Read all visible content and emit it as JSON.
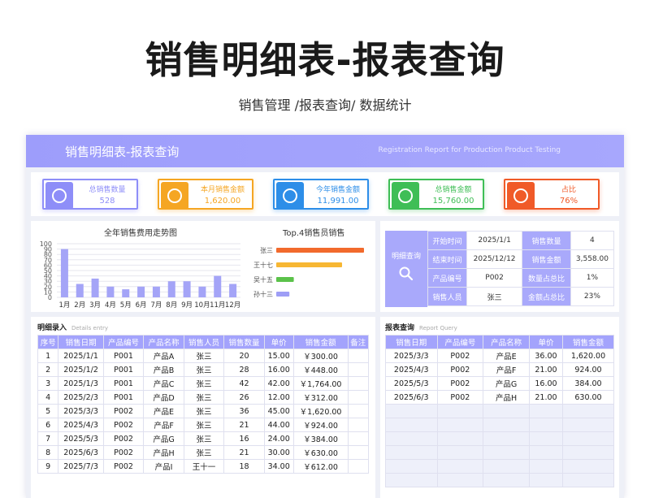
{
  "page": {
    "title": "销售明细表-报表查询",
    "subtitle": "销售管理 /报表查询/ 数据统计"
  },
  "banner": {
    "title": "销售明细表-报表查询",
    "subtitle_en": "Registration Report for Production Product Testing"
  },
  "kpis": [
    {
      "label": "总销售数量",
      "value": "528",
      "color": "#8e8ef8",
      "icon": "hexagon-icon"
    },
    {
      "label": "本月销售金额",
      "value": "1,620.00",
      "color": "#f5a623",
      "icon": "chart-icon"
    },
    {
      "label": "今年销售金额",
      "value": "11,991.00",
      "color": "#2d8ee8",
      "icon": "bar-chart-icon"
    },
    {
      "label": "总销售金额",
      "value": "15,760.00",
      "color": "#3fbe56",
      "icon": "stack-icon"
    },
    {
      "label": "占比",
      "value": "76%",
      "color": "#f05a28",
      "icon": "hexagon-icon"
    }
  ],
  "chart_data": [
    {
      "type": "bar",
      "title": "全年销售费用走势图",
      "categories": [
        "1月",
        "2月",
        "3月",
        "4月",
        "5月",
        "6月",
        "7月",
        "8月",
        "9月",
        "10月",
        "11月",
        "12月"
      ],
      "values": [
        90,
        25,
        35,
        20,
        15,
        20,
        20,
        30,
        30,
        20,
        40,
        25
      ],
      "ylim": [
        0,
        100
      ],
      "yticks": [
        "100",
        "90",
        "80",
        "70",
        "60",
        "50",
        "40",
        "30",
        "20",
        "10",
        "0"
      ],
      "grid": true,
      "color": "#a4a4f7"
    },
    {
      "type": "bar",
      "orientation": "horizontal",
      "title": "Top.4销售员销售",
      "categories": [
        "张三",
        "王十七",
        "吴十五",
        "孙十三"
      ],
      "values": [
        100,
        75,
        20,
        15
      ],
      "colors": [
        "#f26a2c",
        "#f7b733",
        "#5bc24a",
        "#9e9ef6"
      ]
    }
  ],
  "query_info": {
    "button_label": "明细查询",
    "rows": [
      {
        "k1": "开始时间",
        "v1": "2025/1/1",
        "k2": "销售数量",
        "v2": "4"
      },
      {
        "k1": "结束时间",
        "v1": "2025/12/12",
        "k2": "销售金额",
        "v2": "3,558.00"
      },
      {
        "k1": "产品编号",
        "v1": "P002",
        "k2": "数量占总比",
        "v2": "1%"
      },
      {
        "k1": "销售人员",
        "v1": "张三",
        "k2": "金额占总比",
        "v2": "23%"
      }
    ]
  },
  "detail_table": {
    "title": "明细录入",
    "title_en": "Details entry",
    "headers": [
      "序号",
      "销售日期",
      "产品编号",
      "产品名称",
      "销售人员",
      "销售数量",
      "单价",
      "销售金额",
      "备注"
    ],
    "rows": [
      [
        "1",
        "2025/1/1",
        "P001",
        "产品A",
        "张三",
        "20",
        "15.00",
        "￥300.00",
        ""
      ],
      [
        "2",
        "2025/1/2",
        "P001",
        "产品B",
        "张三",
        "28",
        "16.00",
        "￥448.00",
        ""
      ],
      [
        "3",
        "2025/1/3",
        "P001",
        "产品C",
        "张三",
        "42",
        "42.00",
        "￥1,764.00",
        ""
      ],
      [
        "4",
        "2025/2/3",
        "P001",
        "产品D",
        "张三",
        "26",
        "12.00",
        "￥312.00",
        ""
      ],
      [
        "5",
        "2025/3/3",
        "P002",
        "产品E",
        "张三",
        "36",
        "45.00",
        "￥1,620.00",
        ""
      ],
      [
        "6",
        "2025/4/3",
        "P002",
        "产品F",
        "张三",
        "21",
        "44.00",
        "￥924.00",
        ""
      ],
      [
        "7",
        "2025/5/3",
        "P002",
        "产品G",
        "张三",
        "16",
        "24.00",
        "￥384.00",
        ""
      ],
      [
        "8",
        "2025/6/3",
        "P002",
        "产品H",
        "张三",
        "21",
        "30.00",
        "￥630.00",
        ""
      ],
      [
        "9",
        "2025/7/3",
        "P002",
        "产品I",
        "王十一",
        "18",
        "34.00",
        "￥612.00",
        ""
      ]
    ]
  },
  "report_table": {
    "title": "报表查询",
    "title_en": "Report Query",
    "headers": [
      "销售日期",
      "产品编号",
      "产品名称",
      "单价",
      "销售金额"
    ],
    "rows": [
      [
        "2025/3/3",
        "P002",
        "产品E",
        "36.00",
        "1,620.00"
      ],
      [
        "2025/4/3",
        "P002",
        "产品F",
        "21.00",
        "924.00"
      ],
      [
        "2025/5/3",
        "P002",
        "产品G",
        "16.00",
        "384.00"
      ],
      [
        "2025/6/3",
        "P002",
        "产品H",
        "21.00",
        "630.00"
      ]
    ],
    "empty_rows": 6
  }
}
